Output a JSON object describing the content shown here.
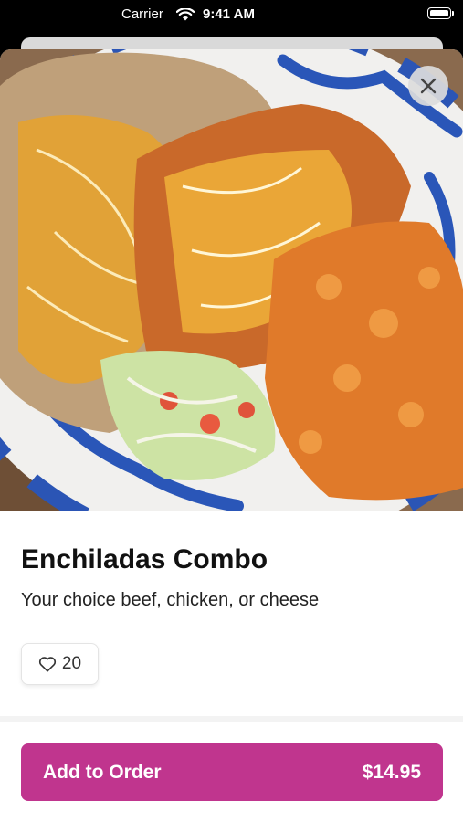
{
  "status_bar": {
    "carrier": "Carrier",
    "time": "9:41 AM"
  },
  "item": {
    "name": "Enchiladas Combo",
    "description": "Your choice beef, chicken, or cheese",
    "likes": "20"
  },
  "actions": {
    "add_to_order_label": "Add to Order",
    "price": "$14.95"
  },
  "colors": {
    "accent": "#c0358e",
    "status_bar": "#000000",
    "sheet_background": "#ffffff"
  },
  "icons": {
    "close": "close-icon",
    "like": "heart-icon",
    "wifi": "wifi-icon",
    "battery": "battery-icon"
  }
}
